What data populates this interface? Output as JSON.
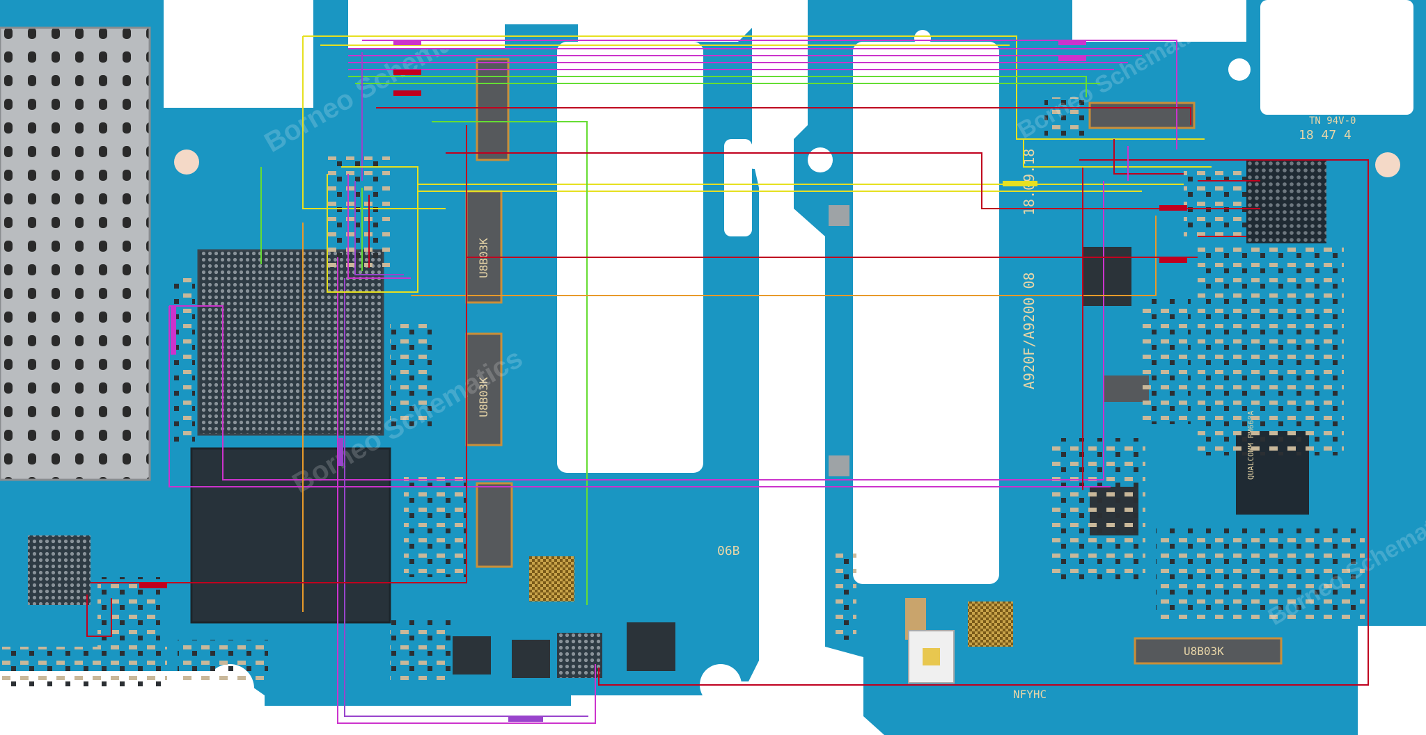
{
  "diagram": {
    "board_left_label": "06B",
    "board_right_model": "A920F/A9200 08",
    "board_right_date": "18.09.18",
    "board_right_ul": "TN 94V-0",
    "board_right_code": "18 47 4",
    "board_right_bottom": "NFYHC",
    "connector_label_1": "U8B03K",
    "connector_label_2": "U8B03K",
    "connector_label_3": "U8B03K",
    "connector_label_4": "U8B03K",
    "chip_label": "QUALCOMM PM660A",
    "watermark": "Borneo Schematics",
    "colors": {
      "pcb": "#1a96c2",
      "pcb_dark": "#0e6f95",
      "red": "#c0001e",
      "magenta": "#cc33cc",
      "purple": "#9944cc",
      "yellow": "#e6e020",
      "green": "#66dd33",
      "orange": "#e89a2a"
    }
  }
}
